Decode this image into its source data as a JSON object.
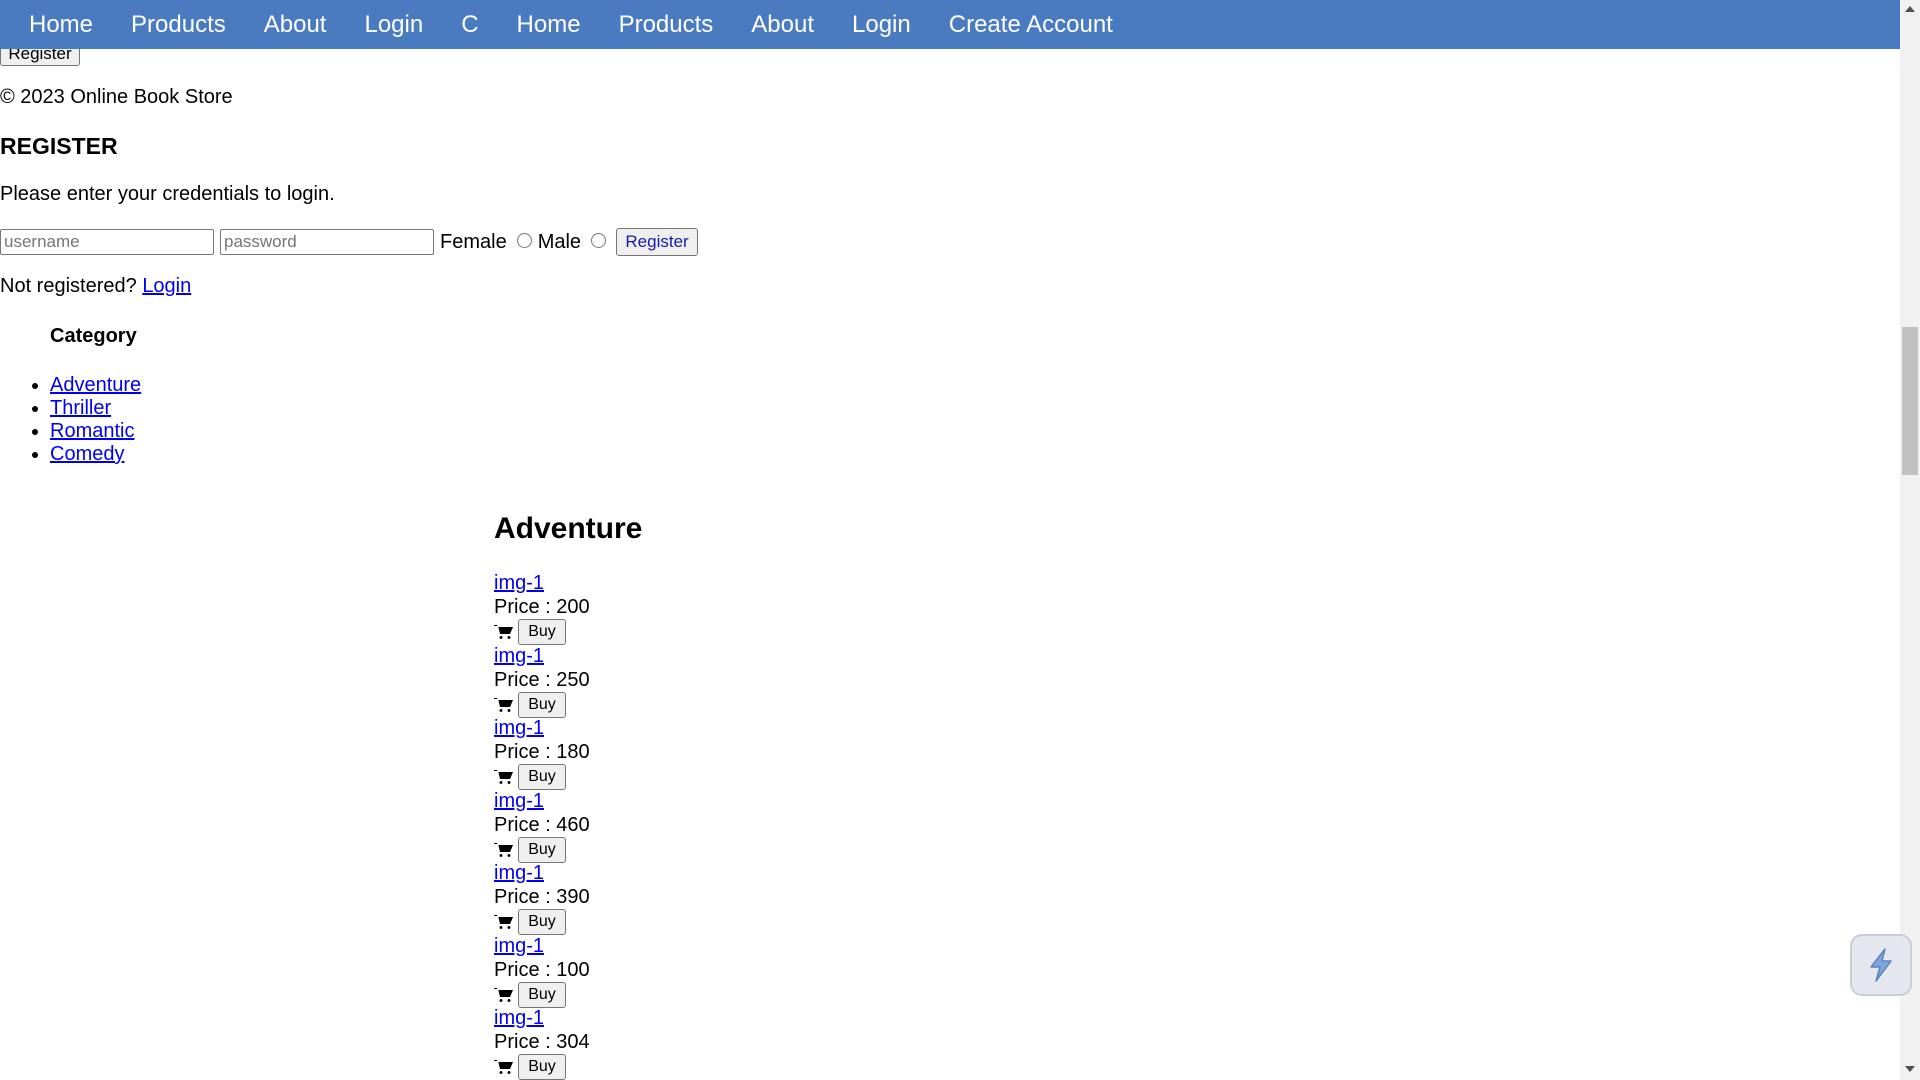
{
  "nav": {
    "items": [
      "Home",
      "Products",
      "About",
      "Login",
      "C",
      "Home",
      "Products",
      "About",
      "Login",
      "Create Account"
    ]
  },
  "top_register_button": "Register",
  "footer": "© 2023 Online Book Store",
  "register": {
    "heading": "REGISTER",
    "instructions": "Please enter your credentials to login.",
    "username_placeholder": "username",
    "password_placeholder": "password",
    "female_label": "Female",
    "male_label": "Male",
    "submit_label": "Register"
  },
  "not_registered": {
    "text": "Not registered?",
    "link": "Login"
  },
  "category": {
    "heading": "Category",
    "items": [
      "Adventure",
      "Thriller",
      "Romantic",
      "Comedy"
    ]
  },
  "section": {
    "heading": "Adventure"
  },
  "products": [
    {
      "img_alt": "img-1",
      "price": "Price : 200",
      "buy": "Buy"
    },
    {
      "img_alt": "img-1",
      "price": "Price : 250",
      "buy": "Buy"
    },
    {
      "img_alt": "img-1",
      "price": "Price : 180",
      "buy": "Buy"
    },
    {
      "img_alt": "img-1",
      "price": "Price : 460",
      "buy": "Buy"
    },
    {
      "img_alt": "img-1",
      "price": "Price : 390",
      "buy": "Buy"
    },
    {
      "img_alt": "img-1",
      "price": "Price : 100",
      "buy": "Buy"
    },
    {
      "img_alt": "img-1",
      "price": "Price : 304",
      "buy": "Buy"
    }
  ],
  "colors": {
    "navbar": "#4a7bc1",
    "link": "#0000ee"
  },
  "icons": {
    "cart": "shopping-cart-icon",
    "floating": "lightning-icon"
  }
}
